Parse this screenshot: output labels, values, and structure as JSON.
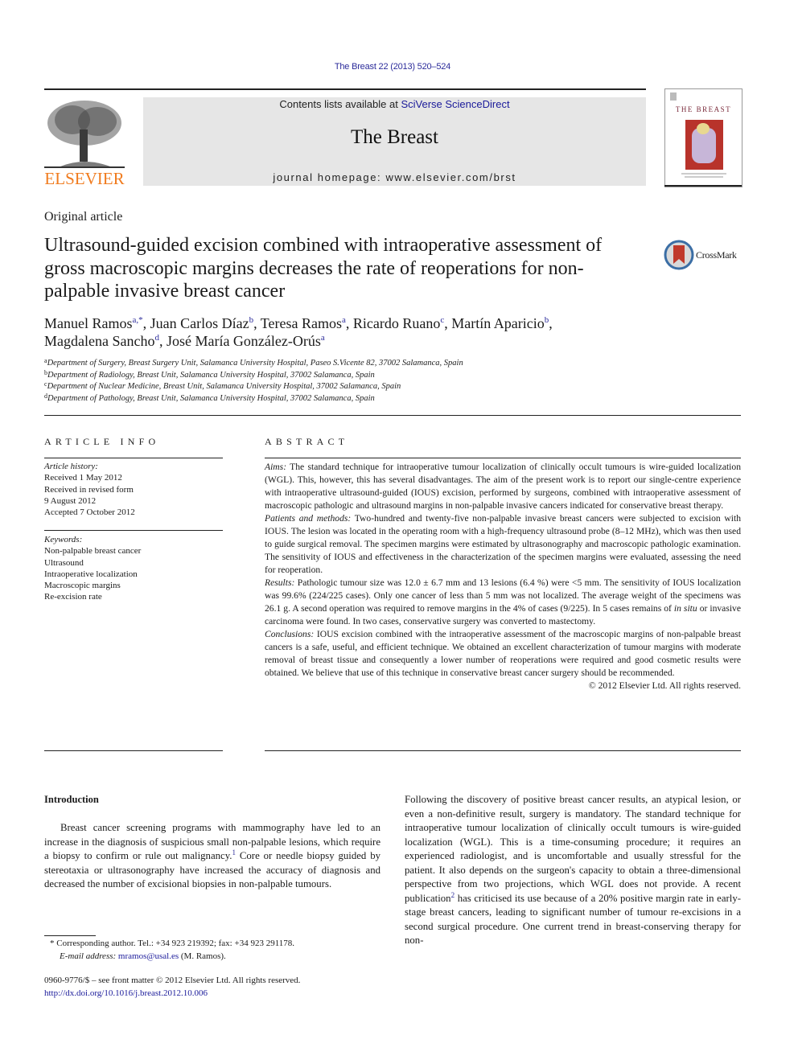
{
  "header": {
    "running_head": "The Breast 22 (2013) 520–524",
    "contents_prefix": "Contents lists available at ",
    "contents_link": "SciVerse ScienceDirect",
    "journal_name": "The Breast",
    "homepage": "journal homepage: www.elsevier.com/brst",
    "publisher_word": "ELSEVIER",
    "cover_title": "THE BREAST",
    "crossmark_label": "CrossMark"
  },
  "colors": {
    "link": "#2b2b9a",
    "elsevier_orange": "#f07b1e",
    "masthead_bg": "#e6e6e6",
    "crossmark_red": "#c0392b"
  },
  "article": {
    "type": "Original article",
    "title": "Ultrasound-guided excision combined with intraoperative assessment of gross macroscopic margins decreases the rate of reoperations for non-palpable invasive breast cancer",
    "authors": [
      {
        "name": "Manuel Ramos",
        "sup": "a,*",
        "sep": ", "
      },
      {
        "name": "Juan Carlos Díaz",
        "sup": "b",
        "sep": ", "
      },
      {
        "name": "Teresa Ramos",
        "sup": "a",
        "sep": ", "
      },
      {
        "name": "Ricardo Ruano",
        "sup": "c",
        "sep": ", "
      },
      {
        "name": "Martín Aparicio",
        "sup": "b",
        "sep": ","
      },
      {
        "name": "Magdalena Sancho",
        "sup": "d",
        "sep": ", "
      },
      {
        "name": "José María González-Orús",
        "sup": "a",
        "sep": ""
      }
    ],
    "affiliations": [
      {
        "label": "a",
        "text": "Department of Surgery, Breast Surgery Unit, Salamanca University Hospital, Paseo S.Vicente 82, 37002 Salamanca, Spain"
      },
      {
        "label": "b",
        "text": "Department of Radiology, Breast Unit, Salamanca University Hospital, 37002 Salamanca, Spain"
      },
      {
        "label": "c",
        "text": "Department of Nuclear Medicine, Breast Unit, Salamanca University Hospital, 37002 Salamanca, Spain"
      },
      {
        "label": "d",
        "text": "Department of Pathology, Breast Unit, Salamanca University Hospital, 37002 Salamanca, Spain"
      }
    ]
  },
  "article_info": {
    "heading": "ARTICLE INFO",
    "history_label": "Article history:",
    "history": [
      "Received 1 May 2012",
      "Received in revised form",
      "9 August 2012",
      "Accepted 7 October 2012"
    ],
    "keywords_label": "Keywords:",
    "keywords": [
      "Non-palpable breast cancer",
      "Ultrasound",
      "Intraoperative localization",
      "Macroscopic margins",
      "Re-excision rate"
    ]
  },
  "abstract": {
    "heading": "ABSTRACT",
    "aims_label": "Aims:",
    "aims": " The standard technique for intraoperative tumour localization of clinically occult tumours is wire-guided localization (WGL). This, however, this has several disadvantages. The aim of the present work is to report our single-centre experience with intraoperative ultrasound-guided (IOUS) excision, performed by surgeons, combined with intraoperative assessment of macroscopic pathologic and ultrasound margins in non-palpable invasive cancers indicated for conservative breast therapy.",
    "methods_label": "Patients and methods:",
    "methods": " Two-hundred and twenty-five non-palpable invasive breast cancers were subjected to excision with IOUS. The lesion was located in the operating room with a high-frequency ultrasound probe (8–12 MHz), which was then used to guide surgical removal. The specimen margins were estimated by ultrasonography and macroscopic pathologic examination. The sensitivity of IOUS and effectiveness in the characterization of the specimen margins were evaluated, assessing the need for reoperation.",
    "results_label": "Results:",
    "results_a": " Pathologic tumour size was 12.0 ± 6.7 mm and 13 lesions (6.4 %) were <5 mm. The sensitivity of IOUS localization was 99.6% (224/225 cases). Only one cancer of less than 5 mm was not localized. The average weight of the specimens was 26.1 g. A second operation was required to remove margins in the 4% of cases (9/225). In 5 cases remains of ",
    "results_italic": "in situ",
    "results_b": " or invasive carcinoma were found. In two cases, conservative surgery was converted to mastectomy.",
    "conclusions_label": "Conclusions:",
    "conclusions": " IOUS excision combined with the intraoperative assessment of the macroscopic margins of non-palpable breast cancers is a safe, useful, and efficient technique. We obtained an excellent characterization of tumour margins with moderate removal of breast tissue and consequently a lower number of reoperations were required and good cosmetic results were obtained. We believe that use of this technique in conservative breast cancer surgery should be recommended.",
    "copyright": "© 2012 Elsevier Ltd. All rights reserved."
  },
  "body": {
    "intro_heading": "Introduction",
    "left_a": "Breast cancer screening programs with mammography have led to an increase in the diagnosis of suspicious small non-palpable lesions, which require a biopsy to confirm or rule out malignancy.",
    "left_ref": "1",
    "left_b": " Core or needle biopsy guided by stereotaxia or ultrasonography have increased the accuracy of diagnosis and decreased the number of excisional biopsies in non-palpable tumours.",
    "right_a": "Following the discovery of positive breast cancer results, an atypical lesion, or even a non-definitive result, surgery is mandatory. The standard technique for intraoperative tumour localization of clinically occult tumours is wire-guided localization (WGL). This is a time-consuming procedure; it requires an experienced radiologist, and is uncomfortable and usually stressful for the patient. It also depends on the surgeon's capacity to obtain a three-dimensional perspective from two projections, which WGL does not provide. A recent publication",
    "right_ref": "2",
    "right_b": " has criticised its use because of a 20% positive margin rate in early-stage breast cancers, leading to significant number of tumour re-excisions in a second surgical procedure. One current trend in breast-conserving therapy for non-"
  },
  "footnotes": {
    "corresponding": "* Corresponding author. Tel.: +34 923 219392; fax: +34 923 291178.",
    "email_label": "E-mail address:",
    "email": "mramos@usal.es",
    "email_suffix": " (M. Ramos).",
    "issn": "0960-9776/$ – see front matter © 2012 Elsevier Ltd. All rights reserved.",
    "doi": "http://dx.doi.org/10.1016/j.breast.2012.10.006"
  }
}
